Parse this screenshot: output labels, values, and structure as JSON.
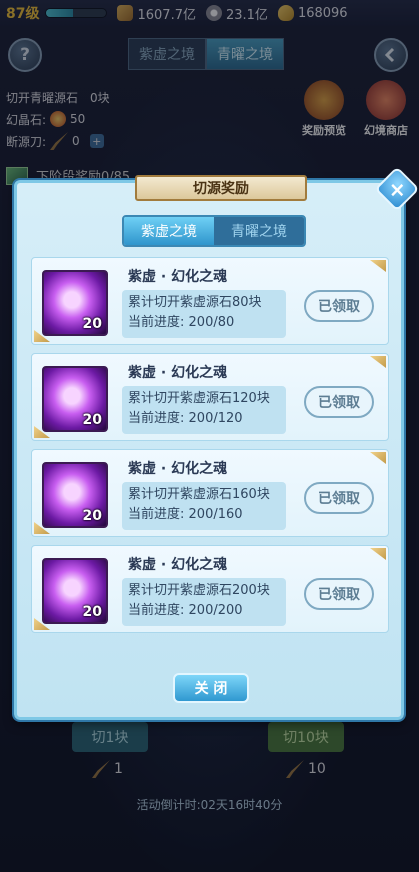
{
  "topbar": {
    "level": "87级",
    "exp_progress": 0.45,
    "gems": "1607.7亿",
    "coins": "23.1亿",
    "gold": "168096"
  },
  "help_icon": "?",
  "top_tabs": [
    "紫虚之境",
    "青曜之境"
  ],
  "info": {
    "cut_label": "切开青曜源石",
    "cut_value": "0块",
    "crystal_label": "幻晶石:",
    "crystal_value": "50",
    "knife_label": "断源刀:",
    "knife_value": "0",
    "plus": "+"
  },
  "side_buttons": {
    "reward_preview": "奖励预览",
    "shop": "幻境商店"
  },
  "next_reward": "下阶段奖励0/85",
  "modal": {
    "title": "切源奖励",
    "tabs": [
      "紫虚之境",
      "青曜之境"
    ],
    "rewards": [
      {
        "name": "紫虚 · 幻化之魂",
        "count": "20",
        "requirement": "累计切开紫虚源石80块",
        "progress_label": "当前进度:",
        "progress": "200/80",
        "button": "已领取"
      },
      {
        "name": "紫虚 · 幻化之魂",
        "count": "20",
        "requirement": "累计切开紫虚源石120块",
        "progress_label": "当前进度:",
        "progress": "200/120",
        "button": "已领取"
      },
      {
        "name": "紫虚 · 幻化之魂",
        "count": "20",
        "requirement": "累计切开紫虚源石160块",
        "progress_label": "当前进度:",
        "progress": "200/160",
        "button": "已领取"
      },
      {
        "name": "紫虚 · 幻化之魂",
        "count": "20",
        "requirement": "累计切开紫虚源石200块",
        "progress_label": "当前进度:",
        "progress": "200/200",
        "button": "已领取"
      }
    ],
    "close_button": "关 闭"
  },
  "bottom": {
    "cut1_label": "切1块",
    "cut10_label": "切10块",
    "cost1": "1",
    "cost10": "10",
    "countdown": "活动倒计时:02天16时40分"
  }
}
